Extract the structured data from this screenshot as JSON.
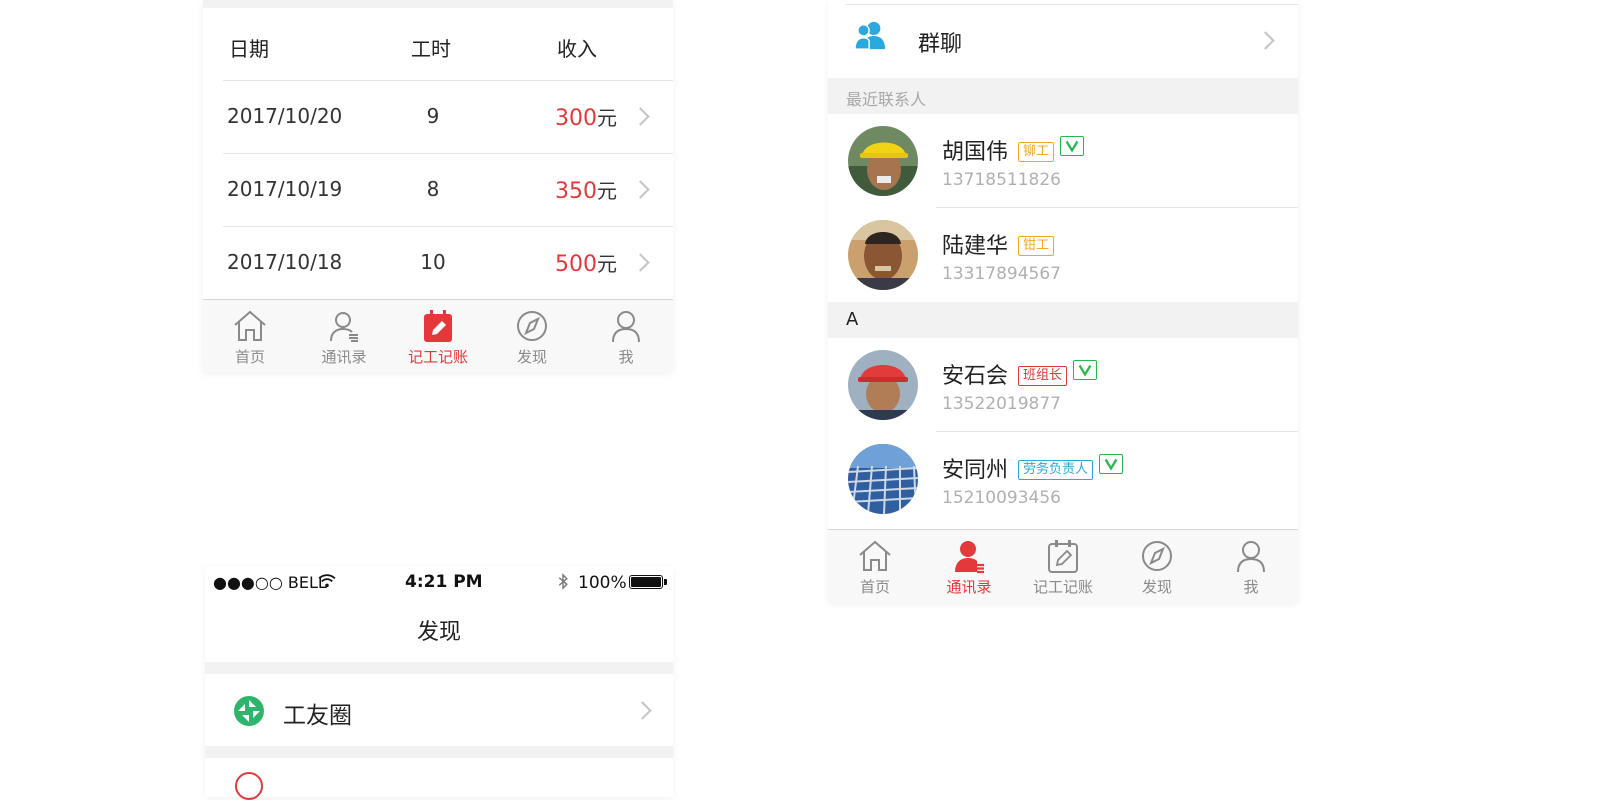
{
  "work_log": {
    "headers": {
      "date": "日期",
      "hours": "工时",
      "income": "收入"
    },
    "rows": [
      {
        "date": "2017/10/20",
        "hours": "9",
        "amount": "300",
        "unit": "元"
      },
      {
        "date": "2017/10/19",
        "hours": "8",
        "amount": "350",
        "unit": "元"
      },
      {
        "date": "2017/10/18",
        "hours": "10",
        "amount": "500",
        "unit": "元"
      }
    ]
  },
  "tabbar_left": {
    "tabs": [
      {
        "label": "首页",
        "icon": "home-icon"
      },
      {
        "label": "通讯录",
        "icon": "contacts-icon"
      },
      {
        "label": "记工记账",
        "icon": "worklog-icon"
      },
      {
        "label": "发现",
        "icon": "compass-icon"
      },
      {
        "label": "我",
        "icon": "profile-icon"
      }
    ],
    "active_index": 2
  },
  "discover": {
    "status_bar": {
      "carrier": "●●●○○ BELL",
      "time": "4:21 PM",
      "battery": "100%"
    },
    "title": "发现",
    "items": [
      {
        "label": "工友圈",
        "icon": "moments-icon"
      }
    ]
  },
  "contacts": {
    "group_chat": {
      "label": "群聊",
      "icon": "group-icon"
    },
    "recent_header": "最近联系人",
    "recent": [
      {
        "name": "胡国伟",
        "tag": "铆工",
        "tag_color": "#f5a623",
        "verified": true,
        "phone": "13718511826",
        "avatar": "yellow-helmet-avatar"
      },
      {
        "name": "陆建华",
        "tag": "钳工",
        "tag_color": "#f5a623",
        "verified": false,
        "phone": "13317894567",
        "avatar": "worker-avatar"
      }
    ],
    "index_header": "A",
    "indexed": [
      {
        "name": "安石会",
        "tag": "班组长",
        "tag_color": "#e5383b",
        "verified": true,
        "phone": "13522019877",
        "avatar": "red-helmet-avatar"
      },
      {
        "name": "安同州",
        "tag": "劳务负责人",
        "tag_color": "#2aa8e0",
        "verified": true,
        "phone": "15210093456",
        "avatar": "steel-structure-avatar"
      }
    ]
  },
  "tabbar_right": {
    "tabs": [
      {
        "label": "首页",
        "icon": "home-icon"
      },
      {
        "label": "通讯录",
        "icon": "contacts-icon"
      },
      {
        "label": "记工记账",
        "icon": "worklog-icon"
      },
      {
        "label": "发现",
        "icon": "compass-icon"
      },
      {
        "label": "我",
        "icon": "profile-icon"
      }
    ],
    "active_index": 1
  },
  "colors": {
    "accent": "#e5383b",
    "verified": "#27b84a",
    "group_icon": "#2aa8e0"
  }
}
